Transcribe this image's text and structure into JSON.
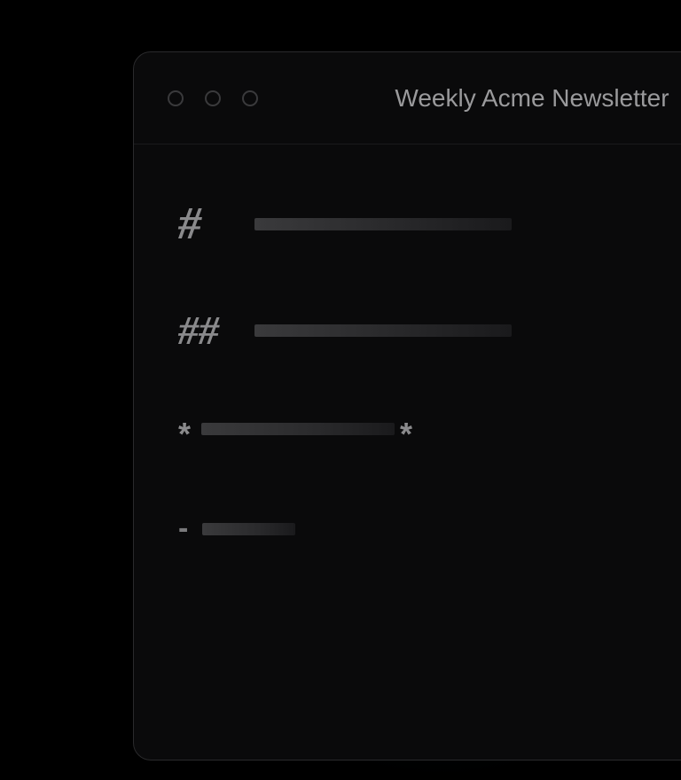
{
  "window": {
    "title": "Weekly Acme Newsletter"
  },
  "markers": {
    "h1": "#",
    "h2": "##",
    "emphasis_open": "*",
    "emphasis_close": "*",
    "list": "-"
  }
}
